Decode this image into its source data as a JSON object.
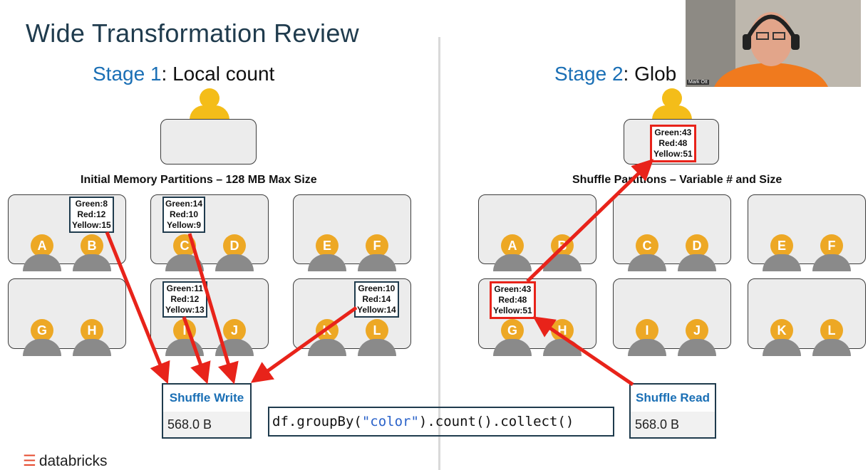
{
  "slide": {
    "title": "Wide Transformation Review",
    "stage1": {
      "label": "Stage 1",
      "suffix": ": Local count"
    },
    "stage2": {
      "label": "Stage 2",
      "suffix": ": Glob"
    },
    "caption_left": "Initial Memory Partitions – 128 MB Max Size",
    "caption_right": "Shuffle Partitions – Variable # and Size"
  },
  "workers_left": [
    "A",
    "B",
    "C",
    "D",
    "E",
    "F",
    "G",
    "H",
    "I",
    "J",
    "K",
    "L"
  ],
  "workers_right": [
    "A",
    "B",
    "C",
    "D",
    "E",
    "F",
    "G",
    "H",
    "I",
    "J",
    "K",
    "L"
  ],
  "counts": {
    "p1": [
      "Green:8",
      "Red:12",
      "Yellow:15"
    ],
    "p2": [
      "Green:14",
      "Red:10",
      "Yellow:9"
    ],
    "p5": [
      "Green:11",
      "Red:12",
      "Yellow:13"
    ],
    "p6": [
      "Green:10",
      "Red:14",
      "Yellow:14"
    ],
    "shuffle": [
      "Green:43",
      "Red:48",
      "Yellow:51"
    ],
    "driver": [
      "Green:43",
      "Red:48",
      "Yellow:51"
    ]
  },
  "shuffle_write": {
    "label": "Shuffle Write",
    "value": "568.0 B"
  },
  "shuffle_read": {
    "label": "Shuffle Read",
    "value": "568.0 B"
  },
  "code": {
    "prefix": "df.groupBy(",
    "arg": "\"color\"",
    "suffix": ").count().collect()"
  },
  "webcam": {
    "name": "Mark Ott"
  },
  "logo": {
    "text": "databricks"
  },
  "colors": {
    "accent_blue": "#1a6fb5",
    "arrow_red": "#e8231a",
    "worker_orange": "#eda825"
  }
}
